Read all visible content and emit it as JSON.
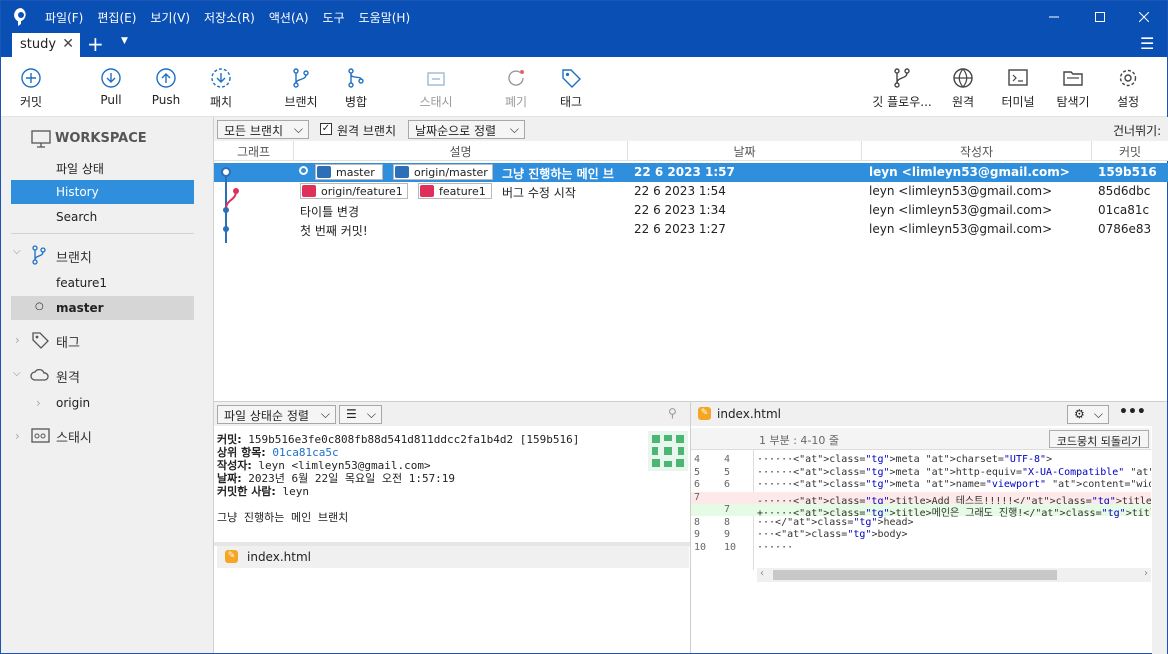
{
  "menu": [
    "파일(F)",
    "편집(E)",
    "보기(V)",
    "저장소(R)",
    "액션(A)",
    "도구",
    "도움말(H)"
  ],
  "tab": {
    "label": "study",
    "plus": "+"
  },
  "toolbar": {
    "commit": "커밋",
    "pull": "Pull",
    "push": "Push",
    "fetch": "패치",
    "branch": "브랜치",
    "merge": "병합",
    "stash": "스태시",
    "discard": "폐기",
    "tag": "태그",
    "gitflow": "깃 플로우...",
    "remote": "원격",
    "terminal": "터미널",
    "explorer": "탐색기",
    "settings": "설정"
  },
  "sidebar": {
    "workspace": "WORKSPACE",
    "file_status": "파일 상태",
    "history": "History",
    "search": "Search",
    "branches": "브랜치",
    "branch_items": [
      "feature1",
      "master"
    ],
    "tags": "태그",
    "remotes": "원격",
    "remote_items": [
      "origin"
    ],
    "stashes": "스태시"
  },
  "filter": {
    "all_branches": "모든 브랜치",
    "remote_branches": "원격 브랜치",
    "sort": "날짜순으로 정렬",
    "skip": "건너뛰기:"
  },
  "columns": {
    "graph": "그래프",
    "desc": "설명",
    "date": "날짜",
    "author": "작성자",
    "commit": "커밋"
  },
  "commits": [
    {
      "tags": [
        "master",
        "origin/master"
      ],
      "desc": "그냥 진행하는 메인 브",
      "date": "22 6 2023 1:57",
      "author": "leyn <limleyn53@gmail.com>",
      "hash": "159b516"
    },
    {
      "tags": [
        "origin/feature1",
        "feature1"
      ],
      "desc": "버그 수정 시작",
      "date": "22 6 2023 1:54",
      "author": "leyn <limleyn53@gmail.com>",
      "hash": "85d6dbc"
    },
    {
      "tags": [],
      "desc": "타이틀 변경",
      "date": "22 6 2023 1:34",
      "author": "leyn <limleyn53@gmail.com>",
      "hash": "01ca81c"
    },
    {
      "tags": [],
      "desc": "첫 번째 커밋!",
      "date": "22 6 2023 1:27",
      "author": "leyn <limleyn53@gmail.com>",
      "hash": "0786e83"
    }
  ],
  "details": {
    "sort": "파일 상태순 정렬",
    "commit_label": "커밋:",
    "commit_value": "159b516e3fe0c808fb88d541d811ddcc2fa1b4d2 [159b516]",
    "parent_label": "상위 항목:",
    "parent_value": "01ca81ca5c",
    "author_label": "작성자:",
    "author_value": "leyn <limleyn53@gmail.com>",
    "date_label": "날짜:",
    "date_value": "2023년 6월 22일 목요일 오전 1:57:19",
    "committer_label": "커밋한 사람:",
    "committer_value": "leyn",
    "message": "그냥 진행하는 메인 브랜치",
    "file": "index.html"
  },
  "diff": {
    "file": "index.html",
    "hunk": "1 부분 : 4-10 줄",
    "revert": "코드뭉치 되돌리기",
    "lines": [
      {
        "o": "4",
        "n": "4",
        "text": "······<meta charset=\"UTF-8\">",
        "kind": "ctx"
      },
      {
        "o": "5",
        "n": "5",
        "text": "······<meta http-equiv=\"X-UA-Compatible\" content=\"IE=edge\">",
        "kind": "ctx"
      },
      {
        "o": "6",
        "n": "6",
        "text": "······<meta name=\"viewport\" content=\"width=device-width, initial-",
        "kind": "ctx"
      },
      {
        "o": "7",
        "n": "",
        "text": "-·····<title>Add 테스트!!!!!</title>",
        "kind": "del"
      },
      {
        "o": "",
        "n": "7",
        "text": "+·····<title>메인은 그래도 진행!</title>",
        "kind": "add"
      },
      {
        "o": "8",
        "n": "8",
        "text": "···</head>",
        "kind": "ctx"
      },
      {
        "o": "9",
        "n": "9",
        "text": "···<body>",
        "kind": "ctx"
      },
      {
        "o": "10",
        "n": "10",
        "text": "······",
        "kind": "ctx"
      }
    ]
  },
  "colors": {
    "accent": "#0a4fb3",
    "selection": "#2f8fdd",
    "branch_blue": "#2a6fb8",
    "branch_red": "#e0305a"
  }
}
